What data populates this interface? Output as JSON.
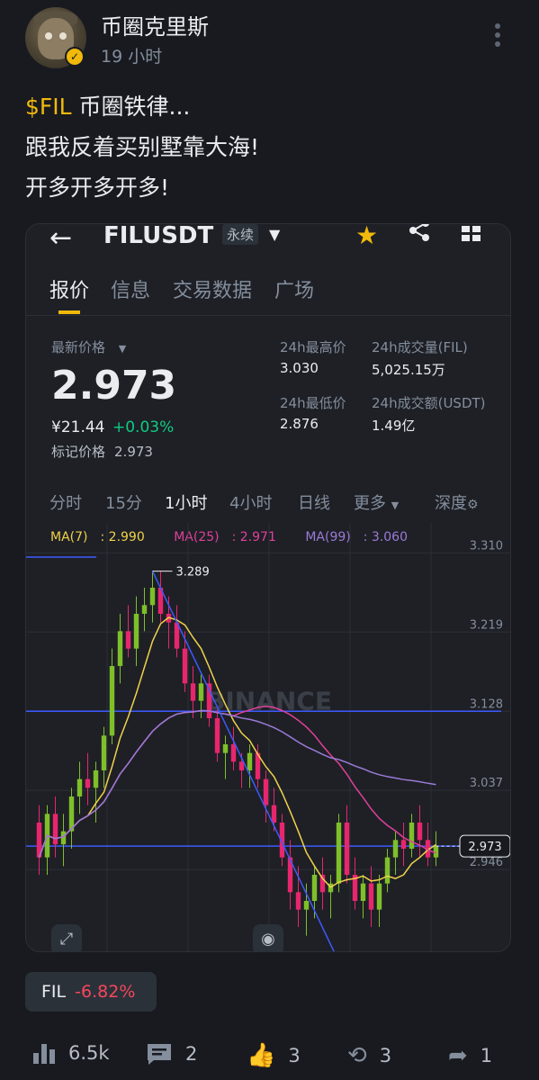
{
  "post": {
    "author": "币圈克里斯",
    "time": "19 小时",
    "ticker": "$FIL",
    "line1_rest": " 币圈铁律...",
    "line2": "跟我反着买别墅靠大海!",
    "line3": "开多开多开多!"
  },
  "market": {
    "symbol": "FILUSDT",
    "contract_type": "永续",
    "tabs": [
      "报价",
      "信息",
      "交易数据",
      "广场"
    ],
    "active_tab": "报价",
    "last_price_label": "最新价格",
    "last_price": "2.973",
    "cny_price": "¥21.44",
    "change_pct": "+0.03%",
    "mark_price_label": "标记价格",
    "mark_price": "2.973",
    "high_label": "24h最高价",
    "high": "3.030",
    "low_label": "24h最低价",
    "low": "2.876",
    "vol_fil_label": "24h成交量(FIL)",
    "vol_fil": "5,025.15万",
    "vol_usdt_label": "24h成交额(USDT)",
    "vol_usdt": "1.49亿",
    "intervals": [
      "分时",
      "15分",
      "1小时",
      "4小时",
      "日线",
      "更多",
      "深度"
    ],
    "active_interval": "1小时",
    "watermark": "BINANCE"
  },
  "chart_data": {
    "type": "candlestick",
    "interval": "1h",
    "ylim": [
      2.85,
      3.33
    ],
    "y_ticks": [
      3.31,
      3.219,
      3.128,
      3.037,
      2.946
    ],
    "y_tick_labels": [
      "3.310",
      "3.219",
      "3.128",
      "3.037",
      "2.946"
    ],
    "high_marker": "3.289",
    "last_price_marker": "2.973",
    "horizontal_levels": [
      3.128,
      2.973
    ],
    "ma": [
      {
        "name": "MA(7)",
        "value": "2.990",
        "color": "#f0d24a"
      },
      {
        "name": "MA(25)",
        "value": "2.971",
        "color": "#e0409a"
      },
      {
        "name": "MA(99)",
        "value": "3.060",
        "color": "#9b7ad6"
      }
    ],
    "up_color": "#7fbf2a",
    "down_color": "#e8266e",
    "candles": [
      [
        3.0,
        3.02,
        2.94,
        2.96
      ],
      [
        2.96,
        3.02,
        2.94,
        3.01
      ],
      [
        3.01,
        3.03,
        2.96,
        2.975
      ],
      [
        2.975,
        3.01,
        2.95,
        2.99
      ],
      [
        2.99,
        3.04,
        2.97,
        3.03
      ],
      [
        3.03,
        3.07,
        3.01,
        3.05
      ],
      [
        3.05,
        3.08,
        3.02,
        3.04
      ],
      [
        3.04,
        3.07,
        3.0,
        3.06
      ],
      [
        3.06,
        3.11,
        3.04,
        3.1
      ],
      [
        3.1,
        3.2,
        3.09,
        3.18
      ],
      [
        3.18,
        3.24,
        3.16,
        3.22
      ],
      [
        3.22,
        3.25,
        3.19,
        3.2
      ],
      [
        3.2,
        3.26,
        3.18,
        3.24
      ],
      [
        3.24,
        3.27,
        3.22,
        3.25
      ],
      [
        3.25,
        3.289,
        3.23,
        3.27
      ],
      [
        3.27,
        3.289,
        3.23,
        3.24
      ],
      [
        3.24,
        3.26,
        3.2,
        3.23
      ],
      [
        3.23,
        3.25,
        3.19,
        3.2
      ],
      [
        3.2,
        3.22,
        3.15,
        3.16
      ],
      [
        3.16,
        3.18,
        3.12,
        3.14
      ],
      [
        3.14,
        3.17,
        3.12,
        3.16
      ],
      [
        3.16,
        3.17,
        3.11,
        3.12
      ],
      [
        3.12,
        3.13,
        3.07,
        3.08
      ],
      [
        3.08,
        3.1,
        3.05,
        3.09
      ],
      [
        3.09,
        3.11,
        3.06,
        3.07
      ],
      [
        3.07,
        3.08,
        3.04,
        3.06
      ],
      [
        3.06,
        3.09,
        3.04,
        3.08
      ],
      [
        3.08,
        3.09,
        3.04,
        3.05
      ],
      [
        3.05,
        3.06,
        3.0,
        3.02
      ],
      [
        3.02,
        3.04,
        2.99,
        3.0
      ],
      [
        3.0,
        3.01,
        2.95,
        2.96
      ],
      [
        2.96,
        2.98,
        2.9,
        2.92
      ],
      [
        2.92,
        2.95,
        2.88,
        2.9
      ],
      [
        2.9,
        2.93,
        2.87,
        2.91
      ],
      [
        2.91,
        2.95,
        2.89,
        2.94
      ],
      [
        2.94,
        2.96,
        2.9,
        2.92
      ],
      [
        2.92,
        2.94,
        2.89,
        2.93
      ],
      [
        2.93,
        3.01,
        2.92,
        3.0
      ],
      [
        3.0,
        3.02,
        2.93,
        2.94
      ],
      [
        2.94,
        2.96,
        2.9,
        2.91
      ],
      [
        2.91,
        2.94,
        2.89,
        2.93
      ],
      [
        2.93,
        2.95,
        2.88,
        2.9
      ],
      [
        2.9,
        2.94,
        2.88,
        2.93
      ],
      [
        2.93,
        2.97,
        2.92,
        2.96
      ],
      [
        2.96,
        2.99,
        2.94,
        2.98
      ],
      [
        2.98,
        3.0,
        2.95,
        2.97
      ],
      [
        2.97,
        3.01,
        2.96,
        3.0
      ],
      [
        3.0,
        3.02,
        2.96,
        2.98
      ],
      [
        2.98,
        3.0,
        2.95,
        2.96
      ],
      [
        2.96,
        2.99,
        2.95,
        2.973
      ]
    ]
  },
  "coin_tag": {
    "symbol": "FIL",
    "change": "-6.82%"
  },
  "actions": {
    "views": "6.5k",
    "comments": "2",
    "likes": "3",
    "reposts": "3",
    "shares": "1"
  }
}
